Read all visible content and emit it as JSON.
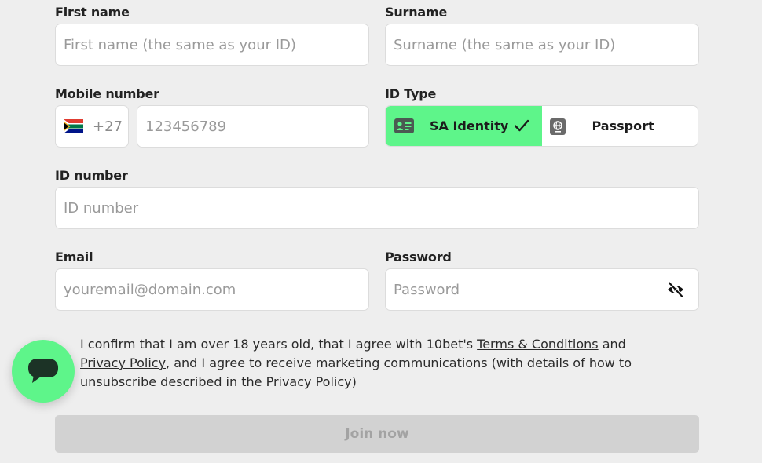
{
  "form": {
    "first_name": {
      "label": "First name",
      "placeholder": "First name (the same as your ID)",
      "value": ""
    },
    "surname": {
      "label": "Surname",
      "placeholder": "Surname (the same as your ID)",
      "value": ""
    },
    "mobile": {
      "label": "Mobile number",
      "country_code": "+27",
      "flag": "south-africa-flag-icon",
      "placeholder": "123456789",
      "value": ""
    },
    "id_type": {
      "label": "ID Type",
      "options": [
        {
          "label": "SA Identity",
          "icon": "id-card-icon",
          "selected": true
        },
        {
          "label": "Passport",
          "icon": "passport-icon",
          "selected": false
        }
      ]
    },
    "id_number": {
      "label": "ID number",
      "placeholder": "ID number",
      "value": ""
    },
    "email": {
      "label": "Email",
      "placeholder": "youremail@domain.com",
      "value": ""
    },
    "password": {
      "label": "Password",
      "placeholder": "Password",
      "value": "",
      "toggle_icon": "eye-off-icon"
    },
    "consent": {
      "text_1": "I confirm that I am over 18 years old, that I agree with 10bet's ",
      "terms_link": "Terms & Conditions",
      "text_2": " and ",
      "privacy_link": "Privacy Policy",
      "text_3": ", and I agree to receive marketing communications (with details of how to unsubscribe described in the Privacy Policy)"
    },
    "submit_label": "Join now"
  },
  "chat": {
    "icon": "chat-bubble-icon"
  },
  "colors": {
    "accent": "#5ef58a",
    "background": "#eeeeee",
    "button_disabled": "#d2d2d2",
    "button_disabled_text": "#a3a3a3"
  }
}
